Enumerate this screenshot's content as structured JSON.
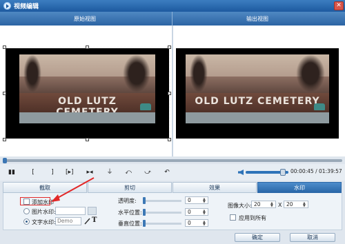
{
  "window": {
    "title": "视频编辑",
    "close_glyph": "✕"
  },
  "views": {
    "original_label": "原始视图",
    "output_label": "输出视图"
  },
  "preview": {
    "sign_text": "OLD LUTZ CEMETERY"
  },
  "controls": {
    "play_glyph": "▮▮",
    "mark_in_glyph": "[",
    "mark_out_glyph": "]",
    "clip_glyph": "[▸]",
    "split_glyph": "▸◂",
    "cut_glyph": "⏚",
    "rotate_left_glyph": "⤺",
    "rotate_right_glyph": "⤻",
    "undo_glyph": "↶",
    "volume_level": 0.87,
    "time_display": "00:00:45 / 01:39:57"
  },
  "tabs": [
    {
      "label": "截取",
      "active": false
    },
    {
      "label": "剪切",
      "active": false
    },
    {
      "label": "效果",
      "active": false
    },
    {
      "label": "水印",
      "active": true
    }
  ],
  "watermark_panel": {
    "add_watermark_label": "添加水印",
    "image_watermark_label": "图片水印:",
    "text_watermark_label": "文字水印:",
    "text_watermark_value": "Demo",
    "text_tool_glyph": "T",
    "transparency_label": "透明度:",
    "transparency_value": "0",
    "horizontal_label": "水平位置:",
    "horizontal_value": "0",
    "vertical_label": "垂直位置:",
    "vertical_value": "0",
    "image_size_label": "图像大小:",
    "image_width": "20",
    "image_x": "X",
    "image_height": "20",
    "apply_all_label": "应用到所有"
  },
  "buttons": {
    "ok_label": "确定",
    "cancel_label": "取消"
  },
  "colors": {
    "accent": "#2a67a8",
    "highlight": "#e22828"
  }
}
